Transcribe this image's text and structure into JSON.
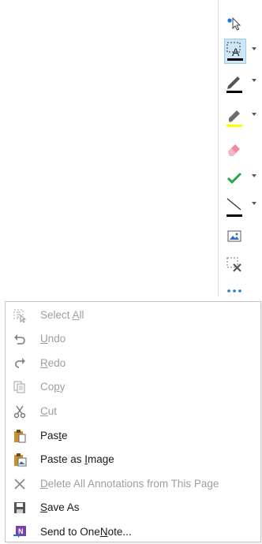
{
  "toolbar": {
    "tools": [
      {
        "id": "select-pointer",
        "icon": "select-pointer-icon"
      },
      {
        "id": "text-box",
        "icon": "text-box-icon",
        "selected": true,
        "color": "#000000",
        "dropdown": true
      },
      {
        "id": "pen",
        "icon": "pen-icon",
        "color": "#000000",
        "dropdown": true
      },
      {
        "id": "highlighter",
        "icon": "highlighter-icon",
        "color": "#ffff00",
        "dropdown": true
      },
      {
        "id": "eraser",
        "icon": "eraser-icon"
      },
      {
        "id": "checkmark",
        "icon": "checkmark-icon",
        "color": "#2aa64a",
        "dropdown": true
      },
      {
        "id": "line",
        "icon": "line-icon",
        "color": "#000000",
        "dropdown": true
      },
      {
        "id": "insert-image",
        "icon": "image-icon"
      },
      {
        "id": "delete-selection",
        "icon": "delete-selection-icon"
      },
      {
        "id": "more",
        "icon": "more-icon"
      }
    ]
  },
  "menu": {
    "items": [
      {
        "icon": "select-all-icon",
        "pre": "Select ",
        "key": "A",
        "post": "ll",
        "enabled": false
      },
      {
        "icon": "undo-icon",
        "pre": "",
        "key": "U",
        "post": "ndo",
        "enabled": false
      },
      {
        "icon": "redo-icon",
        "pre": "",
        "key": "R",
        "post": "edo",
        "enabled": false
      },
      {
        "icon": "copy-icon",
        "pre": "Co",
        "key": "p",
        "post": "y",
        "enabled": false
      },
      {
        "icon": "cut-icon",
        "pre": "",
        "key": "C",
        "post": "ut",
        "enabled": false
      },
      {
        "icon": "paste-icon",
        "pre": "Pas",
        "key": "t",
        "post": "e",
        "enabled": true
      },
      {
        "icon": "paste-image-icon",
        "pre": "Paste as ",
        "key": "I",
        "post": "mage",
        "enabled": true
      },
      {
        "icon": "delete-annotations-icon",
        "pre": "",
        "key": "D",
        "post": "elete All Annotations from This Page",
        "enabled": false
      },
      {
        "icon": "save-icon",
        "pre": "",
        "key": "S",
        "post": "ave As",
        "enabled": true
      },
      {
        "icon": "onenote-icon",
        "pre": "Send to One",
        "key": "N",
        "post": "ote...",
        "enabled": true
      }
    ]
  },
  "colors": {
    "accent": "#1e7bd4",
    "selected_bg": "#cde6f7",
    "disabled_text": "#9e9e9e",
    "text": "#1a1a1a"
  }
}
